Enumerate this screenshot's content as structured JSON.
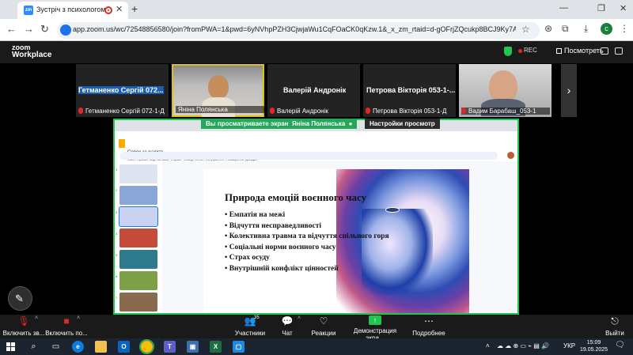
{
  "browser": {
    "tab_title": "Зустріч з психологом",
    "url": "app.zoom.us/wc/72548856580/join?fromPWA=1&pwd=6yNVhpPZH3CjwjaWu1CqFOaCK0qKzw.1&_x_zm_rtaid=d-gOFrjZQcukp8BCJ9Ky7A.17476541550...",
    "profile_initial": "c"
  },
  "zoom": {
    "brand_line1": "zoom",
    "brand_line2": "Workplace",
    "rec_label": "REC",
    "view_label": "Посмотреть"
  },
  "participants": [
    {
      "name": "Гетманенко Сергій 072...",
      "caption": "Гетманенко Сергій 072-1-Д",
      "muted": true,
      "video": false
    },
    {
      "name": "",
      "caption": "Яніна Полянська",
      "muted": false,
      "video": true
    },
    {
      "name": "Валерій Андронік",
      "caption": "Валерій Андронік",
      "muted": true,
      "video": false
    },
    {
      "name": "Петрова Вікторія 053-1-...",
      "caption": "Петрова Вікторія 053-1-Д",
      "muted": true,
      "video": false
    },
    {
      "name": "",
      "caption": "Вадим Барабаш_053-1",
      "muted": true,
      "video": true
    }
  ],
  "share": {
    "viewing_prefix": "Вы просматриваете экран",
    "presenter": "Яніна Полянська",
    "view_options": "Настройки просмотр"
  },
  "shared_screen": {
    "doc_title": "Сорок за радість",
    "menu_items": [
      "Файл",
      "Правка",
      "Вид",
      "Вставка",
      "Формат",
      "Слайд",
      "Об'єкт",
      "Інструменти",
      "Розширення",
      "Довідка"
    ],
    "access_button": "Налаштування доступу",
    "slide_title": "Природа емоцій воєнного часу",
    "bullets": [
      "• Емпатія на межі",
      "• Відчуття несправедливості",
      "• Колективна травма та відчуття спільного горя",
      "• Соціальні норми воєнного часу",
      "• Страх осуду",
      "• Внутрішній конфлікт цінностей"
    ],
    "thumbnail_numbers": [
      "1",
      "2",
      "3",
      "4",
      "5",
      "6",
      "7"
    ]
  },
  "controls": {
    "unmute": "Включить зв...",
    "video": "Включить по...",
    "participants": "Участники",
    "participants_count": "35",
    "chat": "Чат",
    "reactions": "Реакции",
    "share_screen": "Демонстрация экра...",
    "more": "Подробнее",
    "leave": "Выйти"
  },
  "taskbar": {
    "language": "УКР",
    "time": "15:09",
    "date": "19.05.2025"
  },
  "colors": {
    "share_green": "#23c552",
    "mute_red": "#e02828",
    "zoom_blue": "#2d8cff"
  }
}
